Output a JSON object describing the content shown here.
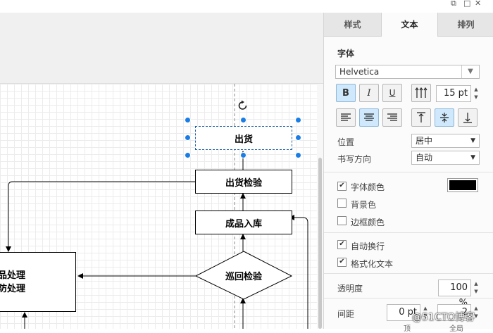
{
  "window_controls": {
    "restore": "⧉",
    "minimize": "□",
    "close": "✕"
  },
  "panel": {
    "tabs": [
      {
        "label": "样式"
      },
      {
        "label": "文本"
      },
      {
        "label": "排列"
      }
    ],
    "active_tab": "文本",
    "font_section_label": "字体",
    "font_family": "Helvetica",
    "format_buttons": {
      "bold": "B",
      "italic": "I",
      "underline": "U"
    },
    "font_size": "15 pt",
    "position_label": "位置",
    "position_value": "居中",
    "writing_direction_label": "书写方向",
    "writing_direction_value": "自动",
    "font_color_label": "字体颜色",
    "font_color_swatch": "#000000",
    "background_color_label": "背景色",
    "border_color_label": "边框颜色",
    "word_wrap_label": "自动换行",
    "formatted_text_label": "格式化文本",
    "opacity_label": "透明度",
    "opacity_value": "100 %",
    "spacing_label": "间距",
    "spacing_top_value": "0 pt",
    "spacing_global_value": "2",
    "spacing_top_caption": "顶",
    "spacing_global_caption": "全局"
  },
  "diagram": {
    "nodes": {
      "shipping": "出货",
      "shipping_inspection": "出货检验",
      "finished_storage": "成品入库",
      "patrol_inspection": "巡回检验",
      "left_box_line1": "品处理",
      "left_box_line2": "防处理"
    }
  },
  "watermark": "@51CTO博客",
  "colors": {
    "accent": "#1a7de6",
    "toggle_on": "#cfe8fb",
    "canvas_grid": "#ececec"
  }
}
